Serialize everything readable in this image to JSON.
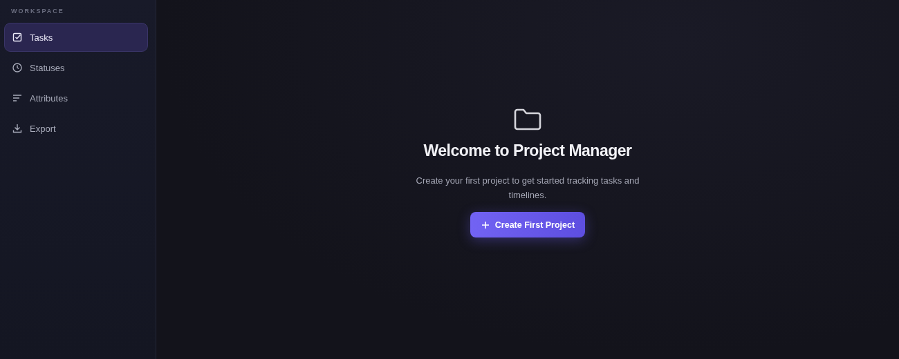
{
  "sidebar": {
    "section_label": "WORKSPACE",
    "items": [
      {
        "label": "Tasks",
        "selected": true
      },
      {
        "label": "Statuses",
        "selected": false
      },
      {
        "label": "Attributes",
        "selected": false
      },
      {
        "label": "Export",
        "selected": false
      }
    ]
  },
  "empty_state": {
    "title": "Welcome to Project Manager",
    "description": "Create your first project to get started tracking tasks and timelines.",
    "button": "Create First Project"
  }
}
